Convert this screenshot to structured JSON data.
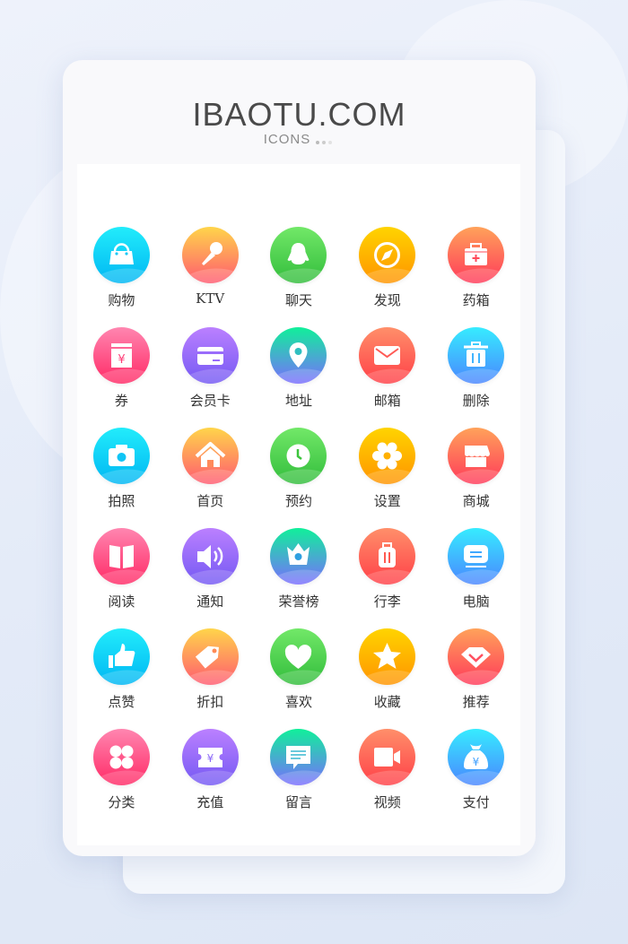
{
  "header": {
    "title": "IBAOTU.COM",
    "subtitle": "ICONS"
  },
  "gradients": {
    "cyan": [
      "#22ecfb",
      "#00b7f3"
    ],
    "orange": [
      "#ffd54a",
      "#ff5a70"
    ],
    "green": [
      "#72e868",
      "#33bd3c"
    ],
    "yellow": [
      "#ffd400",
      "#ff9500"
    ],
    "coral": [
      "#ffa25a",
      "#ff3a5a"
    ],
    "pink": [
      "#ff86b0",
      "#ff2a66"
    ],
    "purple": [
      "#bb80ff",
      "#7459f3"
    ],
    "teal": [
      "#10f09a",
      "#7a6cff"
    ],
    "red": [
      "#ff8f6a",
      "#ff4048"
    ],
    "blue": [
      "#36ecff",
      "#4a86ff"
    ]
  },
  "icons": [
    {
      "label": "购物",
      "icon": "shopping-bag-icon",
      "color": "cyan"
    },
    {
      "label": "KTV",
      "icon": "microphone-icon",
      "color": "orange"
    },
    {
      "label": "聊天",
      "icon": "penguin-icon",
      "color": "green"
    },
    {
      "label": "发现",
      "icon": "compass-icon",
      "color": "yellow"
    },
    {
      "label": "药箱",
      "icon": "medicine-box-icon",
      "color": "coral"
    },
    {
      "label": "券",
      "icon": "coupon-icon",
      "color": "pink"
    },
    {
      "label": "会员卡",
      "icon": "card-icon",
      "color": "purple"
    },
    {
      "label": "地址",
      "icon": "location-pin-icon",
      "color": "teal"
    },
    {
      "label": "邮箱",
      "icon": "mail-icon",
      "color": "red"
    },
    {
      "label": "删除",
      "icon": "trash-icon",
      "color": "blue"
    },
    {
      "label": "拍照",
      "icon": "camera-icon",
      "color": "cyan"
    },
    {
      "label": "首页",
      "icon": "home-icon",
      "color": "orange"
    },
    {
      "label": "预约",
      "icon": "clock-icon",
      "color": "green"
    },
    {
      "label": "设置",
      "icon": "gear-icon",
      "color": "yellow"
    },
    {
      "label": "商城",
      "icon": "store-icon",
      "color": "coral"
    },
    {
      "label": "阅读",
      "icon": "book-icon",
      "color": "pink"
    },
    {
      "label": "通知",
      "icon": "speaker-icon",
      "color": "purple"
    },
    {
      "label": "荣誉榜",
      "icon": "crown-icon",
      "color": "teal"
    },
    {
      "label": "行李",
      "icon": "luggage-icon",
      "color": "red"
    },
    {
      "label": "电脑",
      "icon": "monitor-icon",
      "color": "blue"
    },
    {
      "label": "点赞",
      "icon": "thumbs-up-icon",
      "color": "cyan"
    },
    {
      "label": "折扣",
      "icon": "tag-icon",
      "color": "orange"
    },
    {
      "label": "喜欢",
      "icon": "heart-icon",
      "color": "green"
    },
    {
      "label": "收藏",
      "icon": "star-icon",
      "color": "yellow"
    },
    {
      "label": "推荐",
      "icon": "diamond-icon",
      "color": "coral"
    },
    {
      "label": "分类",
      "icon": "clover-icon",
      "color": "pink"
    },
    {
      "label": "充值",
      "icon": "recharge-ticket-icon",
      "color": "purple"
    },
    {
      "label": "留言",
      "icon": "message-icon",
      "color": "teal"
    },
    {
      "label": "视频",
      "icon": "video-icon",
      "color": "red"
    },
    {
      "label": "支付",
      "icon": "money-bag-icon",
      "color": "blue"
    }
  ]
}
